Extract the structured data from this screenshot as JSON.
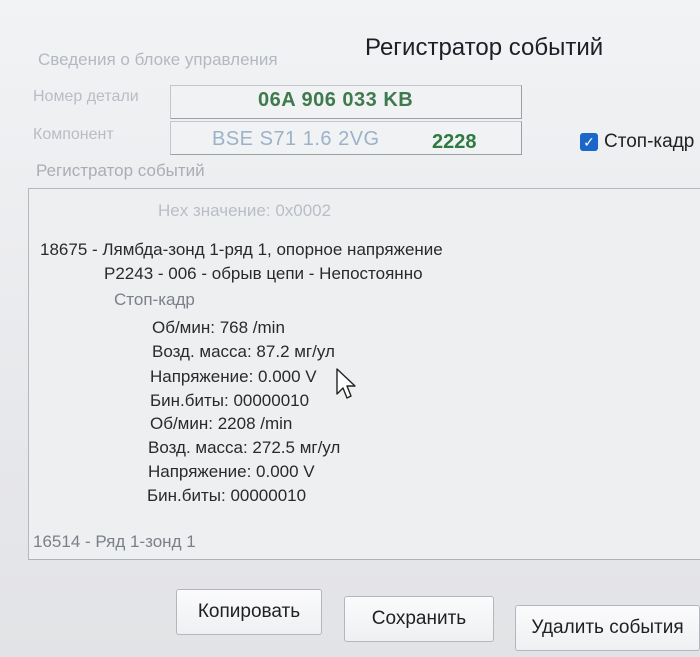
{
  "window": {
    "title": "Регистратор событий"
  },
  "control_unit": {
    "caption": "Сведения о блоке управления",
    "part_number_label": "Номер детали",
    "part_number": "06A 906 033 KB",
    "component_label": "Компонент",
    "component_name": "BSE S71 1.6 2VG",
    "component_code": "2228"
  },
  "freeze_frame": {
    "label": "Стоп-кадр",
    "checked": true
  },
  "log": {
    "caption": "Регистратор событий",
    "hex_line": "Hex значение: 0x0002",
    "event1": {
      "title": "18675 - Лямбда-зонд 1-ряд 1, опорное напряжение",
      "code": "P2243 - 006 - обрыв цепи - Непостоянно",
      "freeze_label": "Стоп-кадр",
      "rows": [
        "Об/мин: 768 /min",
        "Возд. масса: 87.2 мг/ул",
        "Напряжение: 0.000 V",
        "Бин.биты: 00000010",
        "Об/мин: 2208 /min",
        "Возд. масса: 272.5 мг/ул",
        "Напряжение: 0.000 V",
        "Бин.биты: 00000010"
      ]
    },
    "event2": {
      "title": "16514 - Ряд 1-зонд 1"
    }
  },
  "buttons": {
    "copy": "Копировать",
    "save": "Сохранить",
    "delete": "Удалить события"
  },
  "icons": {
    "cursor": "mouse-pointer-icon",
    "check": "checkmark-icon"
  }
}
